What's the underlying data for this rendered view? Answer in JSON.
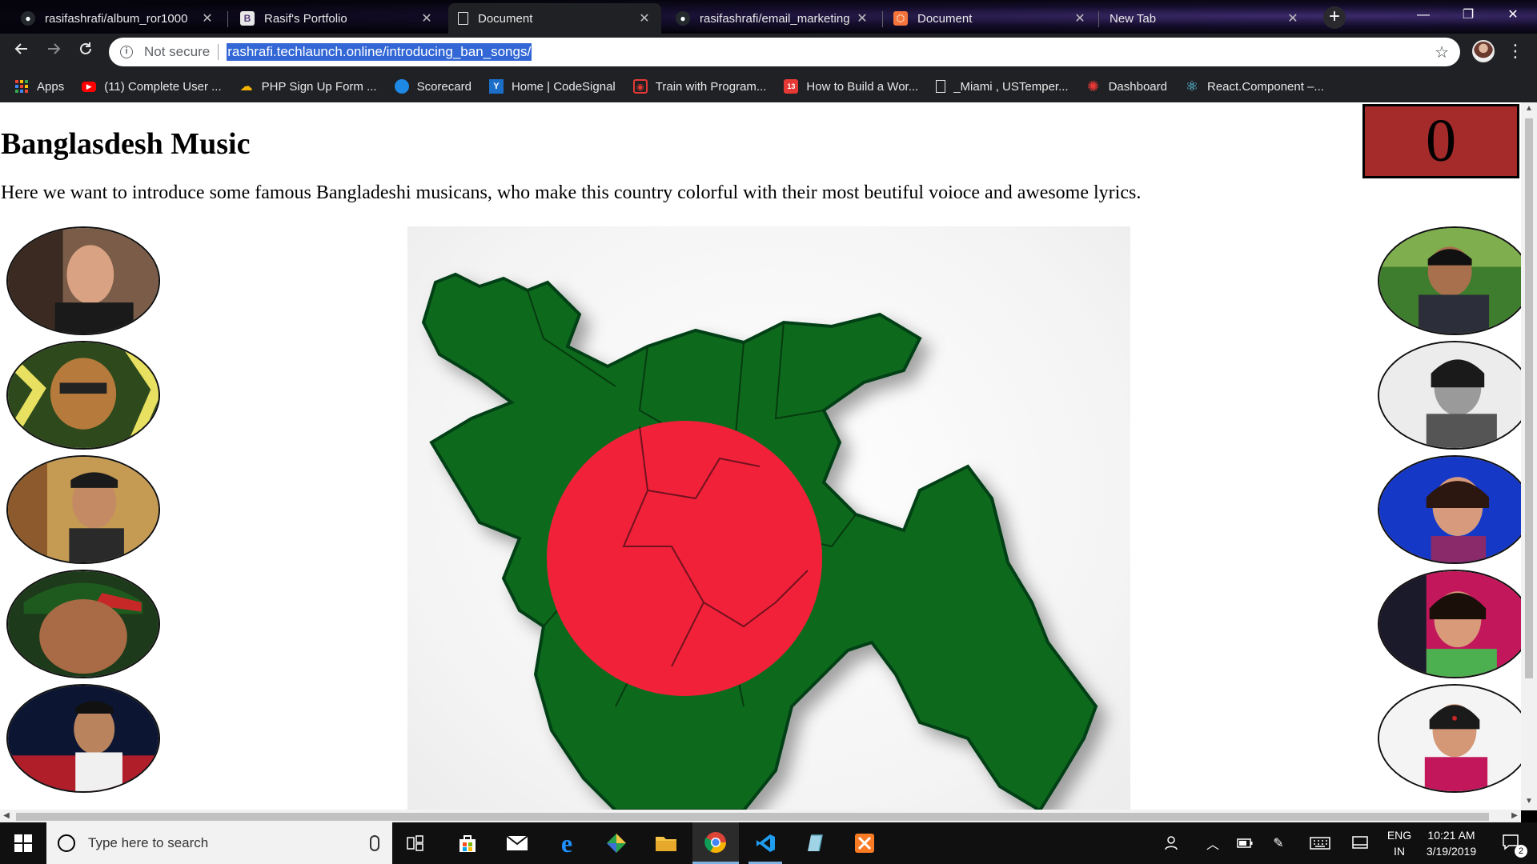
{
  "browser": {
    "tabs": [
      {
        "title": "rasifashrafi/album_ror1000",
        "icon": "github-icon",
        "active": false
      },
      {
        "title": "Rasif's Portfolio",
        "icon": "bootstrap-icon",
        "active": false
      },
      {
        "title": "Document",
        "icon": "document-icon",
        "active": true
      },
      {
        "title": "rasifashrafi/email_marketing",
        "icon": "github-icon",
        "active": false
      },
      {
        "title": "Document",
        "icon": "codepen-icon",
        "active": false
      },
      {
        "title": "New Tab",
        "icon": "none",
        "active": false
      }
    ],
    "close_glyph": "✕",
    "new_tab_glyph": "+",
    "window_controls": {
      "minimize": "—",
      "restore": "❐",
      "close": "✕"
    },
    "omnibox": {
      "security_label": "Not secure",
      "url": "rashrafi.techlaunch.online/introducing_ban_songs/"
    },
    "bookmarks": [
      {
        "label": "Apps",
        "icon": "apps-grid-icon"
      },
      {
        "label": "(11) Complete User ...",
        "icon": "youtube-icon"
      },
      {
        "label": "PHP Sign Up Form ...",
        "icon": "cloud-icon"
      },
      {
        "label": "Scorecard",
        "icon": "scorecard-icon"
      },
      {
        "label": "Home | CodeSignal",
        "icon": "codesignal-icon"
      },
      {
        "label": "Train with Program...",
        "icon": "train-icon"
      },
      {
        "label": "How to Build a Wor...",
        "icon": "calendar-icon"
      },
      {
        "label": "_Miami , USTemper...",
        "icon": "page-icon"
      },
      {
        "label": "Dashboard",
        "icon": "dashboard-icon"
      },
      {
        "label": "React.Component –...",
        "icon": "react-icon"
      }
    ]
  },
  "page": {
    "title": "Banglasdesh Music",
    "intro": "Here we want to introduce some famous Bangladeshi musicans, who make this country colorful with their most beutiful voioce and awesome lyrics.",
    "counter": "0",
    "left_portraits": 5,
    "right_portraits": 5,
    "flag_colors": {
      "green": "#0c6b1f",
      "red": "#f2213a"
    }
  },
  "taskbar": {
    "search_placeholder": "Type here to search",
    "lang_line1": "ENG",
    "lang_line2": "IN",
    "time": "10:21 AM",
    "date": "3/19/2019",
    "notification_count": "2"
  }
}
